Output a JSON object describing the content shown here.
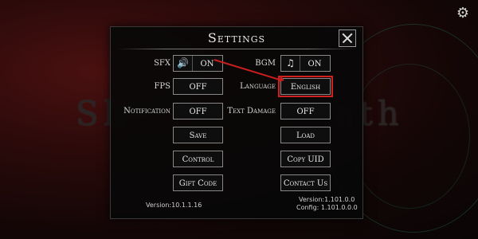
{
  "background": {
    "title_left": "Sh",
    "title_right": "ath"
  },
  "settings_icon": "gear-icon",
  "panel": {
    "title": "Settings",
    "close_icon": "close-icon"
  },
  "rows": {
    "sfx": {
      "label": "SFX",
      "value": "ON",
      "icon": "speaker-icon"
    },
    "bgm": {
      "label": "BGM",
      "value": "ON",
      "icon": "music-note-icon"
    },
    "fps": {
      "label": "FPS",
      "value": "OFF"
    },
    "language": {
      "label": "Language",
      "value": "English"
    },
    "notification": {
      "label": "Notification",
      "value": "OFF"
    },
    "text_damage": {
      "label": "Text Damage",
      "value": "OFF"
    }
  },
  "buttons": {
    "save": "Save",
    "load": "Load",
    "control": "Control",
    "copy_uid": "Copy UID",
    "gift_code": "Gift Code",
    "contact_us": "Contact Us"
  },
  "versions": {
    "left": "Version:10.1.1.16",
    "right_version": "Version:1.101.0.0",
    "right_config": "Config: 1.101.0.0.0"
  },
  "colors": {
    "highlight": "#d02020",
    "panel_bg": "#080808",
    "border": "#888888"
  }
}
